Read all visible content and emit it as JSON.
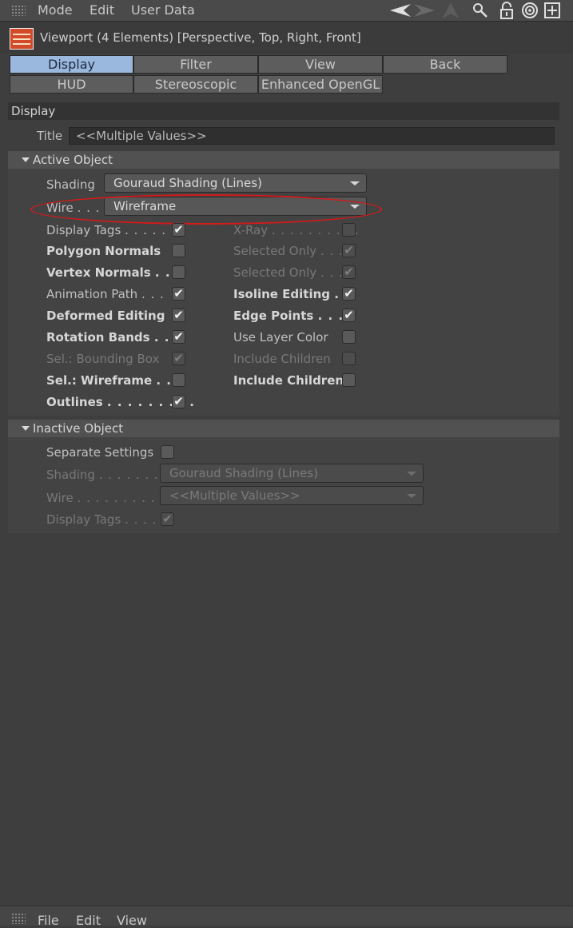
{
  "menubar": {
    "items": [
      "Mode",
      "Edit",
      "User Data"
    ],
    "icons": [
      "back-arrow-icon",
      "forward-arrow-icon",
      "up-arrow-icon",
      "search-icon",
      "lock-icon",
      "target-icon",
      "new-panel-icon"
    ]
  },
  "object": {
    "title": "Viewport (4 Elements) [Perspective, Top, Right, Front]"
  },
  "tabs": [
    "Display",
    "Filter",
    "View",
    "Back",
    "HUD",
    "Stereoscopic",
    "Enhanced OpenGL"
  ],
  "display": {
    "header": "Display",
    "title_label": "Title",
    "title_value": "<<Multiple Values>>"
  },
  "active": {
    "header": "Active Object",
    "shading_label": "Shading",
    "shading_value": "Gouraud Shading (Lines)",
    "wire_label": "Wire",
    "wire_dots": ". . .",
    "wire_value": "Wireframe",
    "left": [
      {
        "label": "Display Tags",
        "dots": ". . . . . .",
        "checked": true
      },
      {
        "label": "Polygon Normals",
        "dots": "",
        "checked": false
      },
      {
        "label": "Vertex Normals",
        "dots": ". . .",
        "checked": false
      },
      {
        "label": "Animation Path",
        "dots": ". . .",
        "checked": true
      },
      {
        "label": "Deformed Editing",
        "dots": "",
        "checked": true
      },
      {
        "label": "Rotation Bands",
        "dots": ". . .",
        "checked": true
      },
      {
        "label": "Sel.: Bounding Box",
        "dots": "",
        "checked": true
      },
      {
        "label": "Sel.: Wireframe",
        "dots": ". . .",
        "checked": false
      },
      {
        "label": "Outlines",
        "dots": ". . . . . . . . .",
        "checked": true
      }
    ],
    "right": [
      {
        "label": "X-Ray",
        "dots": ". . . . . . . . . .",
        "checked": false
      },
      {
        "label": "Selected Only",
        "dots": ". . .",
        "checked": true
      },
      {
        "label": "Selected Only",
        "dots": ". . .",
        "checked": true
      },
      {
        "label": "Isoline Editing",
        "dots": ". .",
        "checked": true
      },
      {
        "label": "Edge Points",
        "dots": ". . . .",
        "checked": true
      },
      {
        "label": "Use Layer Color",
        "dots": "",
        "checked": false
      },
      {
        "label": "Include Children",
        "dots": "",
        "checked": false
      },
      {
        "label": "Include Children",
        "dots": "",
        "checked": false
      }
    ]
  },
  "inactive": {
    "header": "Inactive Object",
    "separate_label": "Separate Settings",
    "shading_label": "Shading",
    "shading_dots": ". . . . . . .",
    "shading_value": "Gouraud Shading (Lines)",
    "wire_label": "Wire",
    "wire_dots": ". . . . . . . . . .",
    "wire_value": "<<Multiple Values>>",
    "tags_label": "Display Tags",
    "tags_dots": ". . . ."
  },
  "bottombar": {
    "items": [
      "File",
      "Edit",
      "View"
    ]
  }
}
